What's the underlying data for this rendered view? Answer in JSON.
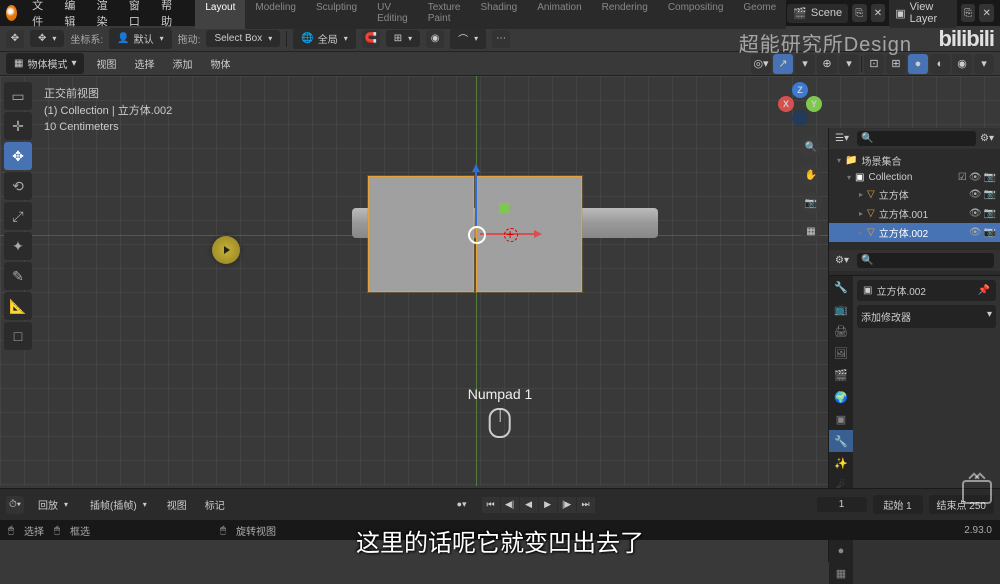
{
  "topmenu": {
    "file": "文件",
    "edit": "编辑",
    "render": "渲染",
    "window": "窗口",
    "help": "帮助"
  },
  "workspaces": [
    "Layout",
    "Modeling",
    "Sculpting",
    "UV Editing",
    "Texture Paint",
    "Shading",
    "Animation",
    "Rendering",
    "Compositing",
    "Geome"
  ],
  "scene": {
    "label": "Scene",
    "viewlayer": "View Layer"
  },
  "toolbar2": {
    "coord_label": "坐标系:",
    "coord_value": "默认",
    "drag_label": "拖动:",
    "drag_value": "Select Box",
    "orient": "全局"
  },
  "header3": {
    "mode": "物体模式",
    "view": "视图",
    "select": "选择",
    "add": "添加",
    "object": "物体"
  },
  "viewport_info": {
    "l1": "正交前视图",
    "l2": "(1) Collection | 立方体.002",
    "l3": "10 Centimeters"
  },
  "hint": "Numpad 1",
  "outliner": {
    "search_placeholder": "  ",
    "collection": "场景集合",
    "collection2": "Collection",
    "items": [
      {
        "name": "立方体"
      },
      {
        "name": "立方体.001"
      },
      {
        "name": "立方体.002"
      }
    ]
  },
  "props": {
    "obj_name": "立方体.002",
    "add_modifier": "添加修改器"
  },
  "timeline": {
    "playback": "回放",
    "keying": "插帧(插帧)",
    "view": "视图",
    "marker": "标记",
    "frame": "1",
    "start_label": "起始",
    "start": "1",
    "end_label": "结束点",
    "end": "250"
  },
  "status": {
    "select": "选择",
    "box": "框选",
    "rotate": "旋转视图",
    "version": "2.93.0"
  },
  "subtitle": "这里的话呢它就变凹出去了",
  "watermark": "超能研究所Design",
  "bilibili": "bilibili"
}
